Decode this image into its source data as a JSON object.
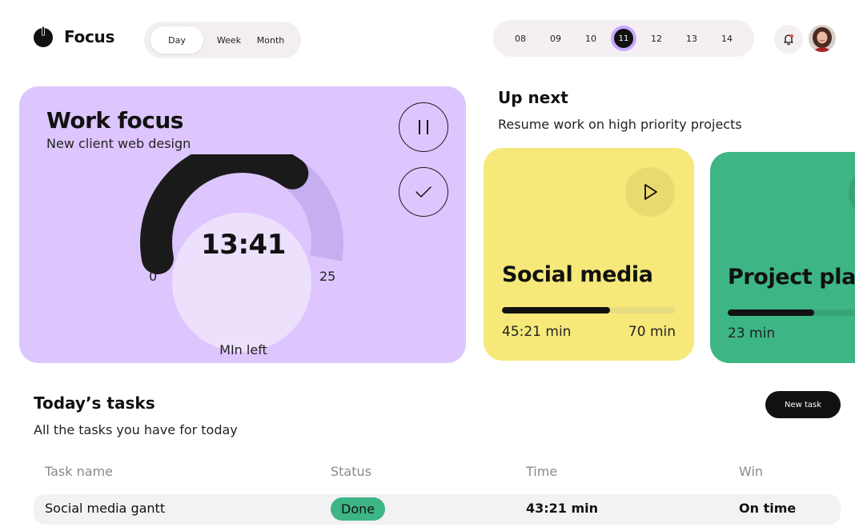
{
  "app": {
    "title": "Focus"
  },
  "view_toggle": {
    "options": [
      "Day",
      "Week",
      "Month"
    ],
    "selected": "Day"
  },
  "date_picker": {
    "dates": [
      "08",
      "09",
      "10",
      "11",
      "12",
      "13",
      "14"
    ],
    "selected": "11"
  },
  "focus_card": {
    "title": "Work focus",
    "subtitle": "New client web design",
    "timer": "13:41",
    "range_min": "0",
    "range_max": "25",
    "caption": "MIn left",
    "progress_fraction": 0.68
  },
  "up_next": {
    "title": "Up next",
    "subtitle": "Resume work on high priority projects",
    "cards": [
      {
        "name": "Social media",
        "elapsed": "45:21 min",
        "total": "70 min",
        "progress": 0.62,
        "color": "#f6e97a",
        "track_color": "#e9dd82"
      },
      {
        "name": "Project plan",
        "elapsed": "23 min",
        "progress": 0.5,
        "color": "#3db585",
        "track_color": "#37a377"
      }
    ]
  },
  "tasks": {
    "title": "Today’s tasks",
    "subtitle": "All the tasks you have for today",
    "new_task_label": "New task",
    "columns": [
      "Task name",
      "Status",
      "Time",
      "Win"
    ],
    "rows": [
      {
        "name": "Social media gantt",
        "status": "Done",
        "time": "43:21 min",
        "win": "On time"
      }
    ]
  },
  "colors": {
    "accent_purple": "#ddc6fd",
    "yellow": "#f6e97a",
    "green": "#3db585",
    "dark": "#111111"
  },
  "icons": [
    "power-icon",
    "bell-icon",
    "pause-icon",
    "check-icon",
    "play-icon"
  ]
}
